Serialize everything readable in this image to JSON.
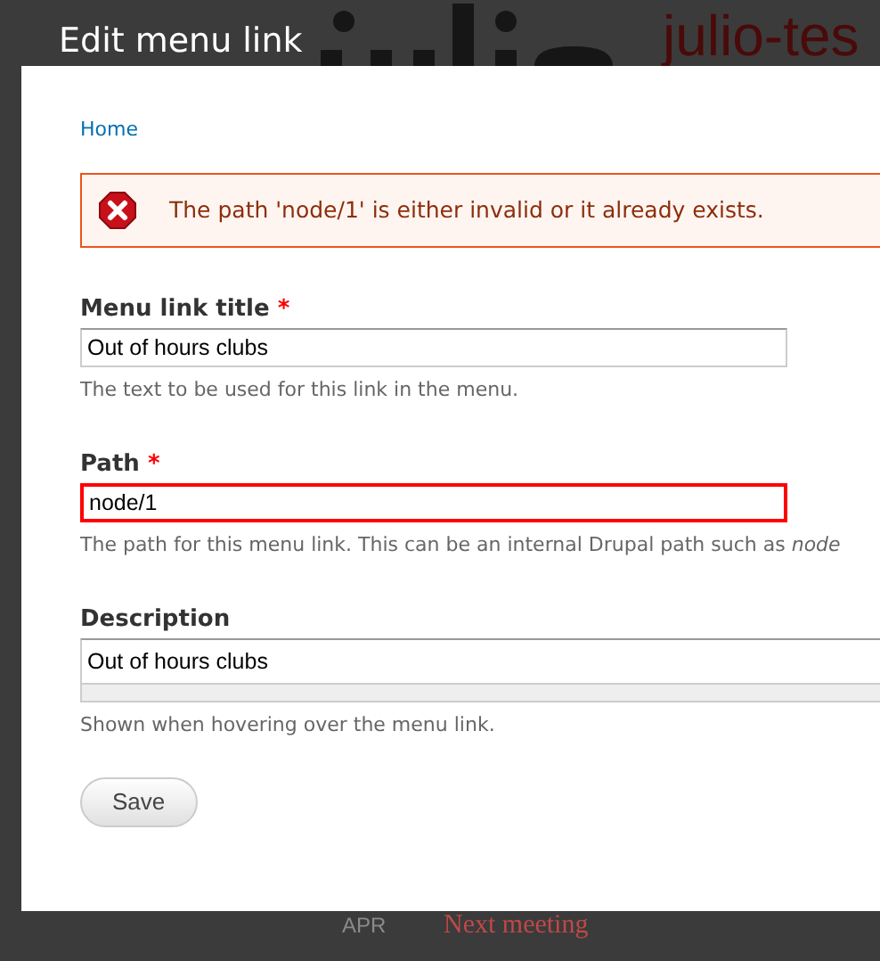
{
  "background": {
    "site_name": "julio-tes",
    "event_month": "APR",
    "event_title": "Next meeting"
  },
  "dialog": {
    "title": "Edit menu link",
    "breadcrumb": [
      "Home"
    ],
    "error": {
      "message": "The path 'node/1' is either invalid or it already exists."
    },
    "fields": [
      {
        "kind": "text",
        "label": "Menu link title",
        "required_mark": "*",
        "value": "Out of hours clubs",
        "error": false,
        "description": "The text to be used for this link in the menu."
      },
      {
        "kind": "text",
        "label": "Path",
        "required_mark": "*",
        "value": "node/1",
        "error": true,
        "description": "The path for this menu link. This can be an internal Drupal path such as *node*"
      },
      {
        "kind": "textarea",
        "label": "Description",
        "value": "Out of hours clubs",
        "error": false,
        "description": "Shown when hovering over the menu link."
      }
    ],
    "buttons": [
      {
        "label": "Save"
      }
    ]
  }
}
